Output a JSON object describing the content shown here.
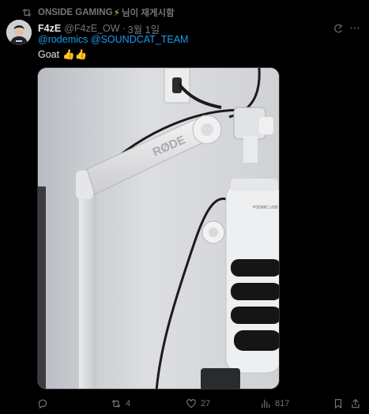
{
  "context": {
    "reposter": "ONSIDE GAMING",
    "suffix": "님이 재게시함"
  },
  "author": {
    "display_name": "F4zE",
    "handle": "@F4zE_OW",
    "separator": "·",
    "date": "3월 1일"
  },
  "tweet": {
    "mentions": [
      "@rodemics",
      "@SOUNDCAT_TEAM"
    ],
    "text": "Goat",
    "emoji": "👍👍"
  },
  "media": {
    "brand_text": "RØDE",
    "mic_label": "PODMIC USB"
  },
  "actions": {
    "reply_count": "",
    "repost_count": "4",
    "like_count": "27",
    "views_count": "817"
  },
  "colors": {
    "background": "#000000",
    "text": "#e7e9ea",
    "muted": "#71767b",
    "link": "#1d9bf0",
    "bolt": "#f4c430"
  }
}
